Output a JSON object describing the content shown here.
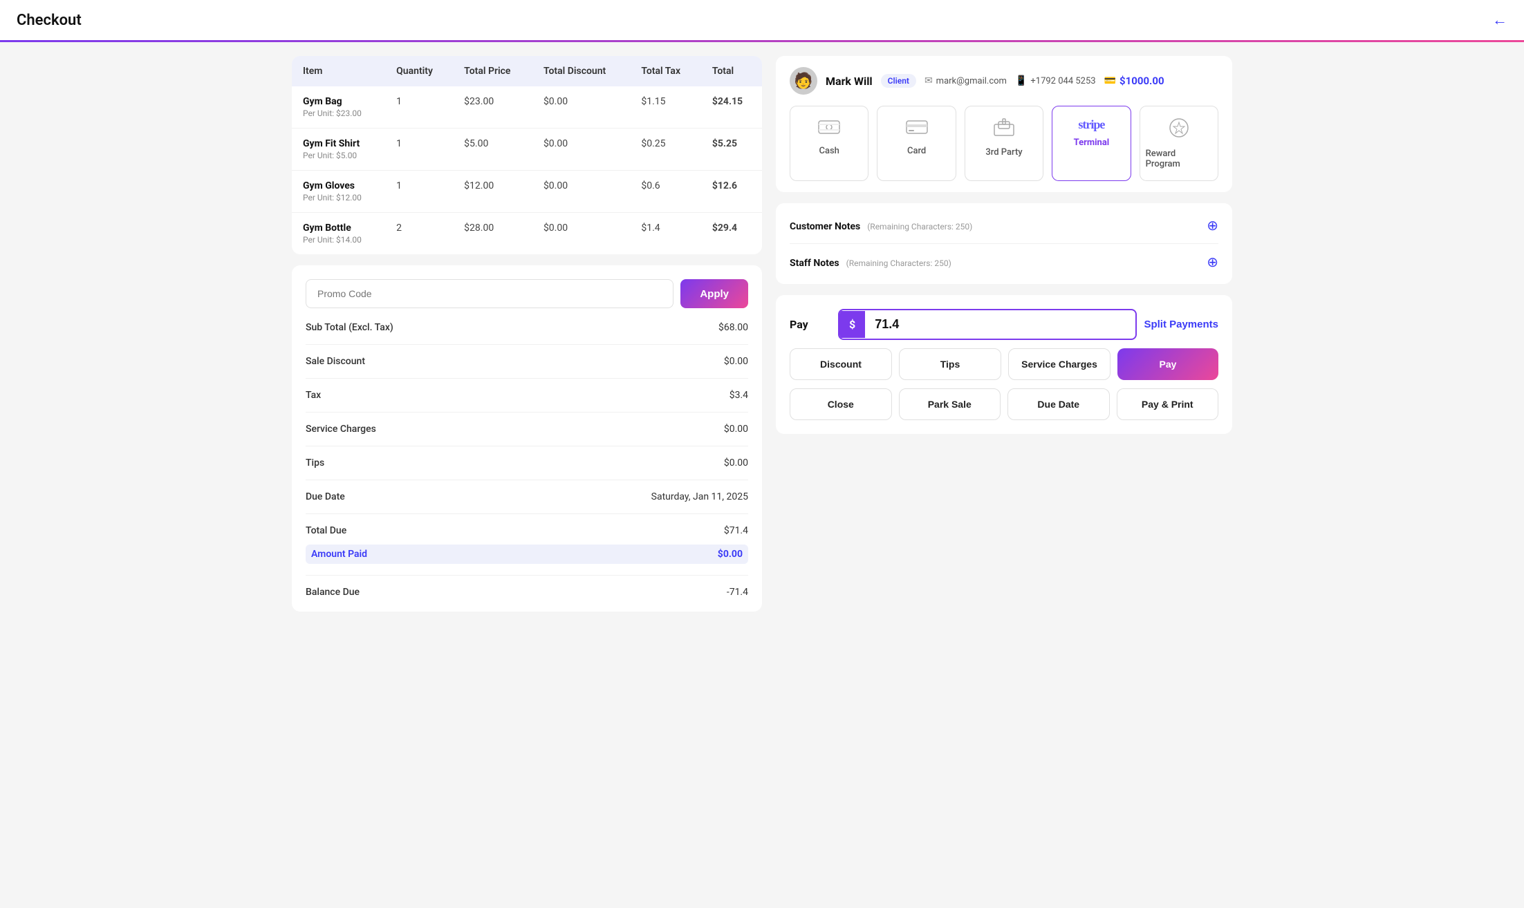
{
  "header": {
    "title": "Checkout",
    "back_label": "←"
  },
  "table": {
    "columns": [
      "Item",
      "Quantity",
      "Total Price",
      "Total Discount",
      "Total Tax",
      "Total"
    ],
    "rows": [
      {
        "name": "Gym Bag",
        "unit_price": "Per Unit: $23.00",
        "quantity": "1",
        "total_price": "$23.00",
        "total_discount": "$0.00",
        "total_tax": "$1.15",
        "total": "$24.15"
      },
      {
        "name": "Gym Fit Shirt",
        "unit_price": "Per Unit: $5.00",
        "quantity": "1",
        "total_price": "$5.00",
        "total_discount": "$0.00",
        "total_tax": "$0.25",
        "total": "$5.25"
      },
      {
        "name": "Gym Gloves",
        "unit_price": "Per Unit: $12.00",
        "quantity": "1",
        "total_price": "$12.00",
        "total_discount": "$0.00",
        "total_tax": "$0.6",
        "total": "$12.6"
      },
      {
        "name": "Gym Bottle",
        "unit_price": "Per Unit: $14.00",
        "quantity": "2",
        "total_price": "$28.00",
        "total_discount": "$0.00",
        "total_tax": "$1.4",
        "total": "$29.4"
      }
    ]
  },
  "promo": {
    "placeholder": "Promo Code",
    "apply_label": "Apply"
  },
  "summary": {
    "subtotal_label": "Sub Total (Excl. Tax)",
    "subtotal_value": "$68.00",
    "sale_discount_label": "Sale Discount",
    "sale_discount_value": "$0.00",
    "tax_label": "Tax",
    "tax_value": "$3.4",
    "service_charges_label": "Service Charges",
    "service_charges_value": "$0.00",
    "tips_label": "Tips",
    "tips_value": "$0.00",
    "due_date_label": "Due Date",
    "due_date_value": "Saturday, Jan 11, 2025",
    "total_due_label": "Total Due",
    "total_due_value": "$71.4",
    "amount_paid_label": "Amount Paid",
    "amount_paid_value": "$0.00",
    "balance_due_label": "Balance Due",
    "balance_due_value": "-71.4"
  },
  "client": {
    "avatar_emoji": "👤",
    "name": "Mark Will",
    "badge": "Client",
    "email": "mark@gmail.com",
    "phone": "+1792 044 5253",
    "wallet": "$1000.00"
  },
  "payment_methods": [
    {
      "id": "cash",
      "label": "Cash",
      "icon": "💵",
      "active": false
    },
    {
      "id": "card",
      "label": "Card",
      "icon": "💳",
      "active": false
    },
    {
      "id": "third_party",
      "label": "3rd Party",
      "icon": "🏛",
      "active": false
    },
    {
      "id": "terminal",
      "label": "Terminal",
      "icon": "stripe",
      "active": true
    },
    {
      "id": "reward_program",
      "label": "Reward Program",
      "icon": "🏅",
      "active": false
    }
  ],
  "notes": {
    "customer_label": "Customer Notes",
    "customer_hint": "(Remaining Characters: 250)",
    "staff_label": "Staff Notes",
    "staff_hint": "(Remaining Characters: 250)"
  },
  "pay_section": {
    "pay_label": "Pay",
    "currency_symbol": "$",
    "amount": "71.4",
    "split_payments_label": "Split Payments",
    "buttons": [
      {
        "id": "discount",
        "label": "Discount"
      },
      {
        "id": "tips",
        "label": "Tips"
      },
      {
        "id": "service_charges",
        "label": "Service Charges"
      },
      {
        "id": "pay",
        "label": "Pay",
        "primary": true
      }
    ],
    "buttons2": [
      {
        "id": "close",
        "label": "Close"
      },
      {
        "id": "park_sale",
        "label": "Park Sale"
      },
      {
        "id": "due_date",
        "label": "Due Date"
      },
      {
        "id": "pay_print",
        "label": "Pay & Print"
      }
    ]
  }
}
